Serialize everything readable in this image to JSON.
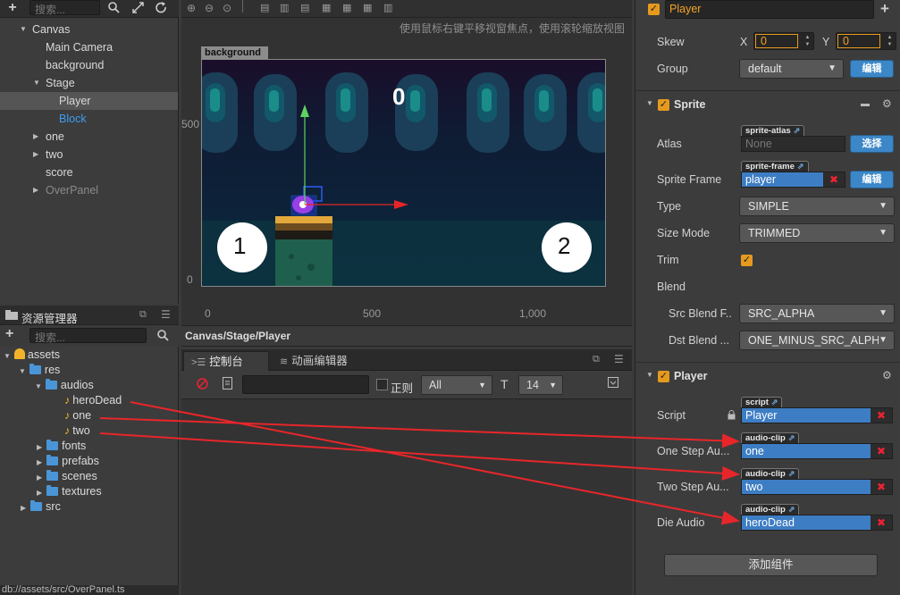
{
  "hierarchy": {
    "search_placeholder": "搜索...",
    "items": [
      {
        "label": "Canvas",
        "expanded": true
      },
      {
        "label": "Main Camera"
      },
      {
        "label": "background"
      },
      {
        "label": "Stage",
        "expanded": true
      },
      {
        "label": "Player",
        "selected": true
      },
      {
        "label": "Block"
      },
      {
        "label": "one",
        "collapsed": true
      },
      {
        "label": "two",
        "collapsed": true
      },
      {
        "label": "score"
      },
      {
        "label": "OverPanel"
      }
    ]
  },
  "assets": {
    "title": "资源管理器",
    "search_placeholder": "搜索...",
    "tree": [
      "assets",
      "res",
      "audios",
      "heroDead",
      "one",
      "two",
      "fonts",
      "prefabs",
      "scenes",
      "textures",
      "src"
    ],
    "status_path": "db://assets/src/OverPanel.ts"
  },
  "scene": {
    "hint": "使用鼠标右键平移视窗焦点，使用滚轮缩放视图",
    "canvas_label": "background",
    "score": "0",
    "button_left": "1",
    "button_right": "2",
    "y_ticks": [
      "500",
      "0"
    ],
    "x_ticks": [
      "0",
      "500",
      "1,000"
    ],
    "breadcrumb": "Canvas/Stage/Player"
  },
  "console": {
    "tab_console": "控制台",
    "tab_anim": "动画编辑器",
    "regex_label": "正则",
    "level_value": "All",
    "font_size": "14"
  },
  "inspector": {
    "node_name": "Player",
    "skew_label": "Skew",
    "skew_x_label": "X",
    "skew_x": "0",
    "skew_y_label": "Y",
    "skew_y": "0",
    "group_label": "Group",
    "group_value": "default",
    "edit_btn": "编辑",
    "select_btn": "选择",
    "sprite_section": "Sprite",
    "atlas_label": "Atlas",
    "atlas_tag": "sprite-atlas",
    "atlas_value": "None",
    "frame_label": "Sprite Frame",
    "frame_tag": "sprite-frame",
    "frame_value": "player",
    "type_label": "Type",
    "type_value": "SIMPLE",
    "sizemode_label": "Size Mode",
    "sizemode_value": "TRIMMED",
    "trim_label": "Trim",
    "blend_label": "Blend",
    "src_blend_label": "Src Blend F..",
    "src_blend_value": "SRC_ALPHA",
    "dst_blend_label": "Dst Blend ...",
    "dst_blend_value": "ONE_MINUS_SRC_ALPHA",
    "player_section": "Player",
    "script_label": "Script",
    "script_tag": "script",
    "script_value": "Player",
    "one_label": "One Step Au...",
    "one_value": "one",
    "two_label": "Two Step Au...",
    "two_value": "two",
    "die_label": "Die Audio",
    "die_value": "heroDead",
    "audio_tag": "audio-clip",
    "add_component": "添加组件"
  },
  "colors": {
    "accent_orange": "#e59a1e",
    "asset_blue": "#3d7dc4",
    "arrow_red": "#e8262a"
  }
}
